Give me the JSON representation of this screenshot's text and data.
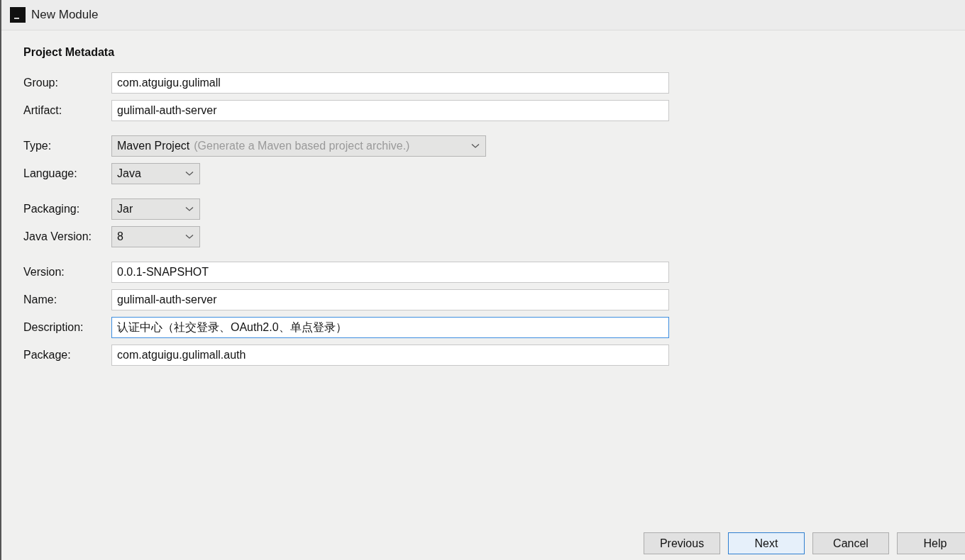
{
  "window": {
    "title": "New Module"
  },
  "section": {
    "title": "Project Metadata"
  },
  "groups": [
    [
      {
        "label": "Group:",
        "kind": "text",
        "value": "com.atguigu.gulimall",
        "focused": false
      },
      {
        "label": "Artifact:",
        "kind": "text",
        "value": "gulimall-auth-server",
        "focused": false
      }
    ],
    [
      {
        "label": "Type:",
        "kind": "wide-select",
        "value": "Maven Project",
        "hint": "(Generate a Maven based project archive.)",
        "focused": false
      },
      {
        "label": "Language:",
        "kind": "select",
        "value": "Java",
        "focused": false
      }
    ],
    [
      {
        "label": "Packaging:",
        "kind": "select",
        "value": "Jar",
        "focused": false
      },
      {
        "label": "Java Version:",
        "kind": "select",
        "value": "8",
        "focused": false
      }
    ],
    [
      {
        "label": "Version:",
        "kind": "text",
        "value": "0.0.1-SNAPSHOT",
        "focused": false
      },
      {
        "label": "Name:",
        "kind": "text",
        "value": "gulimall-auth-server",
        "focused": false
      },
      {
        "label": "Description:",
        "kind": "text",
        "value": "认证中心（社交登录、OAuth2.0、单点登录）",
        "focused": true
      },
      {
        "label": "Package:",
        "kind": "text",
        "value": "com.atguigu.gulimall.auth",
        "focused": false
      }
    ]
  ],
  "buttons": [
    {
      "label": "Previous",
      "default": false
    },
    {
      "label": "Next",
      "default": true
    },
    {
      "label": "Cancel",
      "default": false
    },
    {
      "label": "Help",
      "default": false
    }
  ]
}
